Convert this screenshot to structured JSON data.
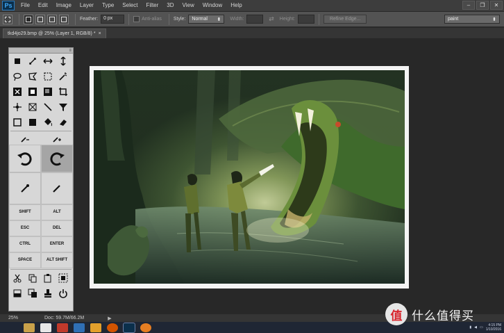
{
  "app": {
    "logo": "Ps",
    "menus": [
      "File",
      "Edit",
      "Image",
      "Layer",
      "Type",
      "Select",
      "Filter",
      "3D",
      "View",
      "Window",
      "Help"
    ],
    "window_controls": [
      "–",
      "❐",
      "✕"
    ]
  },
  "options": {
    "feather_label": "Feather:",
    "feather_value": "0 px",
    "antialias_label": "Anti-alias",
    "style_label": "Style:",
    "style_value": "Normal",
    "width_label": "Width:",
    "height_label": "Height:",
    "swap_glyph": "⇄",
    "refine_label": "Refine Edge...",
    "workspace_value": "paint"
  },
  "document": {
    "tab_title": "tkd4jo29.bmp @ 25% (Layer 1, RGB/8) *",
    "close_glyph": "×"
  },
  "toolpanel": {
    "handle": "≡",
    "keys": {
      "shift": "SHIFT",
      "alt": "ALT",
      "esc": "ESC",
      "del": "DEL",
      "ctrl": "CTRL",
      "enter": "ENTER",
      "space": "SPACE",
      "alt_shift": "ALT SHIFT"
    }
  },
  "status": {
    "zoom": "25%",
    "doc": "Doc: 59.7M/66.2M",
    "arrow": "▶"
  },
  "taskbar": {
    "clock_time": "4:15 PM",
    "clock_date": "1/10/2016"
  },
  "watermark": {
    "logo_char": "值",
    "text": "什么值得买"
  },
  "colors": {
    "accent": "#3fa7f5",
    "panel_bg": "#d7d7d7",
    "workspace": "#282828"
  }
}
